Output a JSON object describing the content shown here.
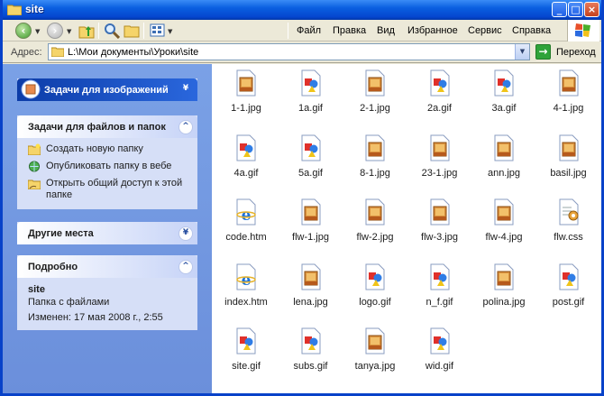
{
  "window": {
    "title": "site"
  },
  "menu": [
    "Файл",
    "Правка",
    "Вид",
    "Избранное",
    "Сервис",
    "Справка"
  ],
  "address": {
    "label": "Адрес:",
    "value": "L:\\Мои документы\\Уроки\\site",
    "go_label": "Переход"
  },
  "sidebar": {
    "image_tasks": {
      "title": "Задачи для изображений"
    },
    "file_tasks": {
      "title": "Задачи для файлов и папок",
      "items": [
        "Создать новую папку",
        "Опубликовать папку в вебе",
        "Открыть общий доступ к этой папке"
      ]
    },
    "other_places": {
      "title": "Другие места"
    },
    "details": {
      "title": "Подробно",
      "name": "site",
      "type": "Папка с файлами",
      "modified": "Изменен: 17 мая 2008 г., 2:55"
    }
  },
  "files": [
    {
      "name": "1-1.jpg",
      "kind": "jpg"
    },
    {
      "name": "1a.gif",
      "kind": "gif"
    },
    {
      "name": "2-1.jpg",
      "kind": "jpg"
    },
    {
      "name": "2a.gif",
      "kind": "gif"
    },
    {
      "name": "3a.gif",
      "kind": "gif"
    },
    {
      "name": "4-1.jpg",
      "kind": "jpg"
    },
    {
      "name": "4a.gif",
      "kind": "gif"
    },
    {
      "name": "5a.gif",
      "kind": "gif"
    },
    {
      "name": "8-1.jpg",
      "kind": "jpg"
    },
    {
      "name": "23-1.jpg",
      "kind": "jpg"
    },
    {
      "name": "ann.jpg",
      "kind": "jpg"
    },
    {
      "name": "basil.jpg",
      "kind": "jpg"
    },
    {
      "name": "code.htm",
      "kind": "htm"
    },
    {
      "name": "flw-1.jpg",
      "kind": "jpg"
    },
    {
      "name": "flw-2.jpg",
      "kind": "jpg"
    },
    {
      "name": "flw-3.jpg",
      "kind": "jpg"
    },
    {
      "name": "flw-4.jpg",
      "kind": "jpg"
    },
    {
      "name": "flw.css",
      "kind": "css"
    },
    {
      "name": "index.htm",
      "kind": "htm"
    },
    {
      "name": "lena.jpg",
      "kind": "jpg"
    },
    {
      "name": "logo.gif",
      "kind": "gif"
    },
    {
      "name": "n_f.gif",
      "kind": "gif"
    },
    {
      "name": "polina.jpg",
      "kind": "jpg"
    },
    {
      "name": "post.gif",
      "kind": "gif"
    },
    {
      "name": "site.gif",
      "kind": "gif"
    },
    {
      "name": "subs.gif",
      "kind": "gif"
    },
    {
      "name": "tanya.jpg",
      "kind": "jpg"
    },
    {
      "name": "wid.gif",
      "kind": "gif"
    }
  ]
}
